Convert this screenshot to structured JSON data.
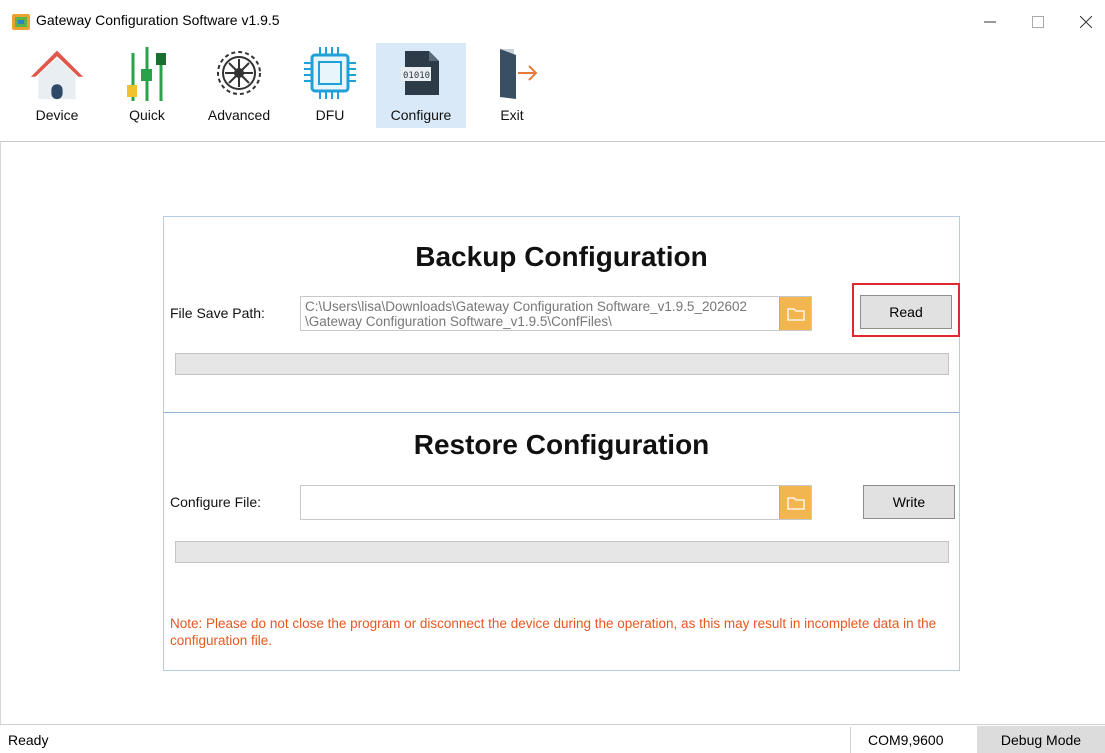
{
  "window": {
    "title": "Gateway Configuration Software v1.9.5",
    "minimize_label": "—",
    "maximize_label": "☐",
    "close_label": "✕"
  },
  "toolbar": {
    "items": [
      {
        "label": "Device",
        "icon": "house-icon"
      },
      {
        "label": "Quick",
        "icon": "sliders-icon"
      },
      {
        "label": "Advanced",
        "icon": "gear-icon"
      },
      {
        "label": "DFU",
        "icon": "chip-icon"
      },
      {
        "label": "Configure",
        "icon": "binary-file-icon",
        "active": true
      },
      {
        "label": "Exit",
        "icon": "exit-door-icon"
      }
    ]
  },
  "backup": {
    "heading": "Backup Configuration",
    "path_label": "File Save Path:",
    "path_line1": "C:\\Users\\lisa\\Downloads\\Gateway Configuration Software_v1.9.5_202602",
    "path_line2": "\\Gateway Configuration Software_v1.9.5\\ConfFiles\\",
    "button_label": "Read",
    "progress": 0
  },
  "restore": {
    "heading": "Restore Configuration",
    "file_label": "Configure File:",
    "file_value": "",
    "button_label": "Write",
    "progress": 0
  },
  "note": "Note: Please do not close the program or disconnect the device during the operation, as this may result in incomplete data in the configuration file.",
  "statusbar": {
    "status": "Ready",
    "port": "COM9,9600",
    "mode_label": "Debug Mode"
  },
  "colors": {
    "accent_active": "#d9e9f7",
    "folder_button": "#f2b54f",
    "highlight": "#e0282e",
    "note": "#e8571f"
  }
}
